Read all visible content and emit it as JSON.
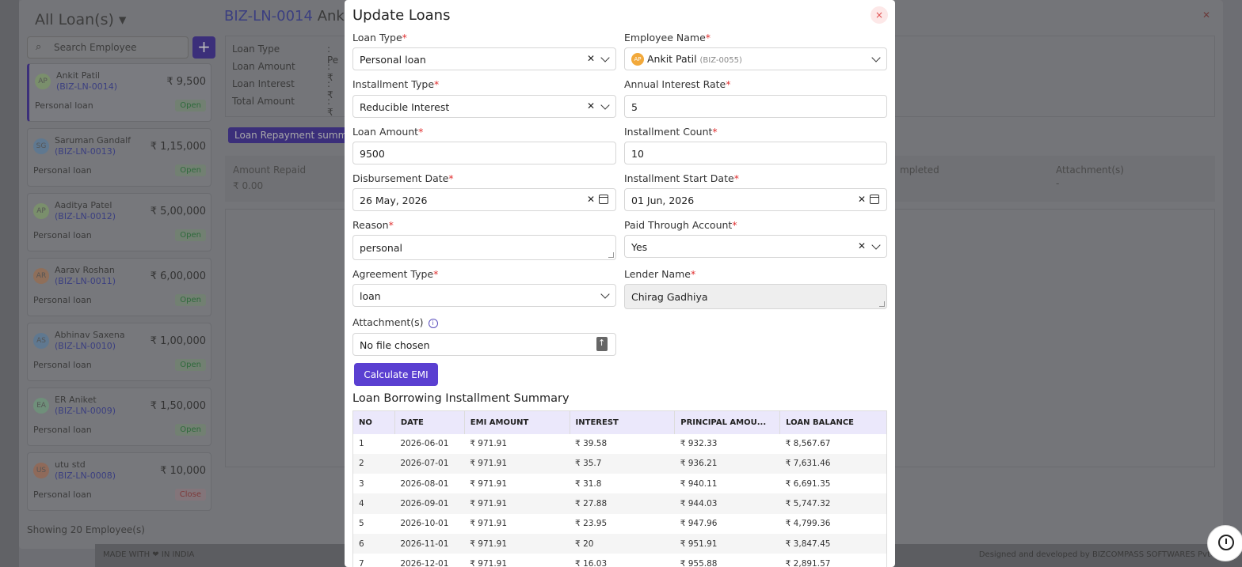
{
  "background": {
    "list_title": "All Loan(s)",
    "search_placeholder": "Search Employee",
    "add_label": "+",
    "employees": [
      {
        "initials": "AP",
        "avatar_color": "#7a8f6c",
        "name": "Ankit Patil",
        "code": "(BIZ-LN-0014)",
        "amount": "₹ 9,500",
        "type": "Personal loan",
        "status": "Open"
      },
      {
        "initials": "SG",
        "avatar_color": "#5f7890",
        "name": "Saruman Gandalf",
        "code": "(BIZ-LN-0013)",
        "amount": "₹ 1,15,000",
        "type": "Personal loan",
        "status": "Open"
      },
      {
        "initials": "AP",
        "avatar_color": "#7a8f6c",
        "name": "Aaditya Patel",
        "code": "(BIZ-LN-0012)",
        "amount": "₹ 5,00,000",
        "type": "Personal loan",
        "status": "Open"
      },
      {
        "initials": "AR",
        "avatar_color": "#8f6f5a",
        "name": "Aarav Roshan",
        "code": "(BIZ-LN-0011)",
        "amount": "₹ 6,00,000",
        "type": "Personal loan",
        "status": "Open"
      },
      {
        "initials": "AS",
        "avatar_color": "#5f7890",
        "name": "Abhinav Saxena",
        "code": "(BIZ-LN-0010)",
        "amount": "₹ 1,00,000",
        "type": "Personal loan",
        "status": "Open"
      },
      {
        "initials": "EA",
        "avatar_color": "#6f8f7a",
        "name": "ER Aniket",
        "code": "(BIZ-LN-0009)",
        "amount": "₹ 1,50,000",
        "type": "Personal loan",
        "status": "Open"
      },
      {
        "initials": "US",
        "avatar_color": "#8f6a5a",
        "name": "utu std",
        "code": "(BIZ-LN-0008)",
        "amount": "₹ 10,000",
        "type": "Personal loan",
        "status": "Close"
      }
    ],
    "list_footer": "Showing 20 Employee(s)",
    "detail_code": "BIZ-LN-0014",
    "detail_name": "Ankit",
    "info_labels": [
      "Loan Type",
      "Loan Amount",
      "Loan Interest",
      "Total Amount"
    ],
    "info_values": [
      ": Pe",
      ": ₹",
      ": ₹",
      ": ₹"
    ],
    "repay_tag": "Loan Repayment summ",
    "stat_amount_repaid_label": "Amount Repaid",
    "stat_amount_repaid_value": "₹ 0.00",
    "stat_completed_label": "mpleted",
    "stat_attach_label": "Attachment(s)",
    "stat_attach_value": "-",
    "footer_left": "MADE WITH ❤ IN INDIA",
    "footer_right": "Designed and developed by BIZCOMPASS SOFTWARES Pvt"
  },
  "modal": {
    "title": "Update Loans",
    "close_label": "×",
    "loan_type": {
      "label": "Loan Type",
      "value": "Personal loan"
    },
    "employee_name": {
      "label": "Employee Name",
      "initials": "AP",
      "value": "Ankit Patil",
      "code": "(BIZ-0055)"
    },
    "installment_type": {
      "label": "Installment Type",
      "value": "Reducible Interest"
    },
    "annual_interest_rate": {
      "label": "Annual Interest Rate",
      "value": "5"
    },
    "loan_amount": {
      "label": "Loan Amount",
      "value": "9500"
    },
    "installment_count": {
      "label": "Installment Count",
      "value": "10"
    },
    "disbursement_date": {
      "label": "Disbursement Date",
      "value": "26 May, 2026"
    },
    "installment_start_date": {
      "label": "Installment Start Date",
      "value": "01 Jun, 2026"
    },
    "reason": {
      "label": "Reason",
      "value": "personal"
    },
    "paid_through_account": {
      "label": "Paid Through Account",
      "value": "Yes"
    },
    "agreement_type": {
      "label": "Agreement Type",
      "value": "loan"
    },
    "lender_name": {
      "label": "Lender Name",
      "value": "Chirag Gadhiya"
    },
    "attachments": {
      "label": "Attachment(s)",
      "value": "No file chosen"
    },
    "calculate_label": "Calculate EMI",
    "summary_title": "Loan Borrowing Installment Summary",
    "table_headers": [
      "NO",
      "DATE",
      "EMI AMOUNT",
      "INTEREST",
      "PRINCIPAL AMOU...",
      "LOAN BALANCE"
    ],
    "rows": [
      [
        "1",
        "2026-06-01",
        "₹ 971.91",
        "₹ 39.58",
        "₹ 932.33",
        "₹ 8,567.67"
      ],
      [
        "2",
        "2026-07-01",
        "₹ 971.91",
        "₹ 35.7",
        "₹ 936.21",
        "₹ 7,631.46"
      ],
      [
        "3",
        "2026-08-01",
        "₹ 971.91",
        "₹ 31.8",
        "₹ 940.11",
        "₹ 6,691.35"
      ],
      [
        "4",
        "2026-09-01",
        "₹ 971.91",
        "₹ 27.88",
        "₹ 944.03",
        "₹ 5,747.32"
      ],
      [
        "5",
        "2026-10-01",
        "₹ 971.91",
        "₹ 23.95",
        "₹ 947.96",
        "₹ 4,799.36"
      ],
      [
        "6",
        "2026-11-01",
        "₹ 971.91",
        "₹ 20",
        "₹ 951.91",
        "₹ 3,847.45"
      ],
      [
        "7",
        "2026-12-01",
        "₹ 971.91",
        "₹ 16.03",
        "₹ 955.88",
        "₹ 2,891.57"
      ]
    ]
  }
}
